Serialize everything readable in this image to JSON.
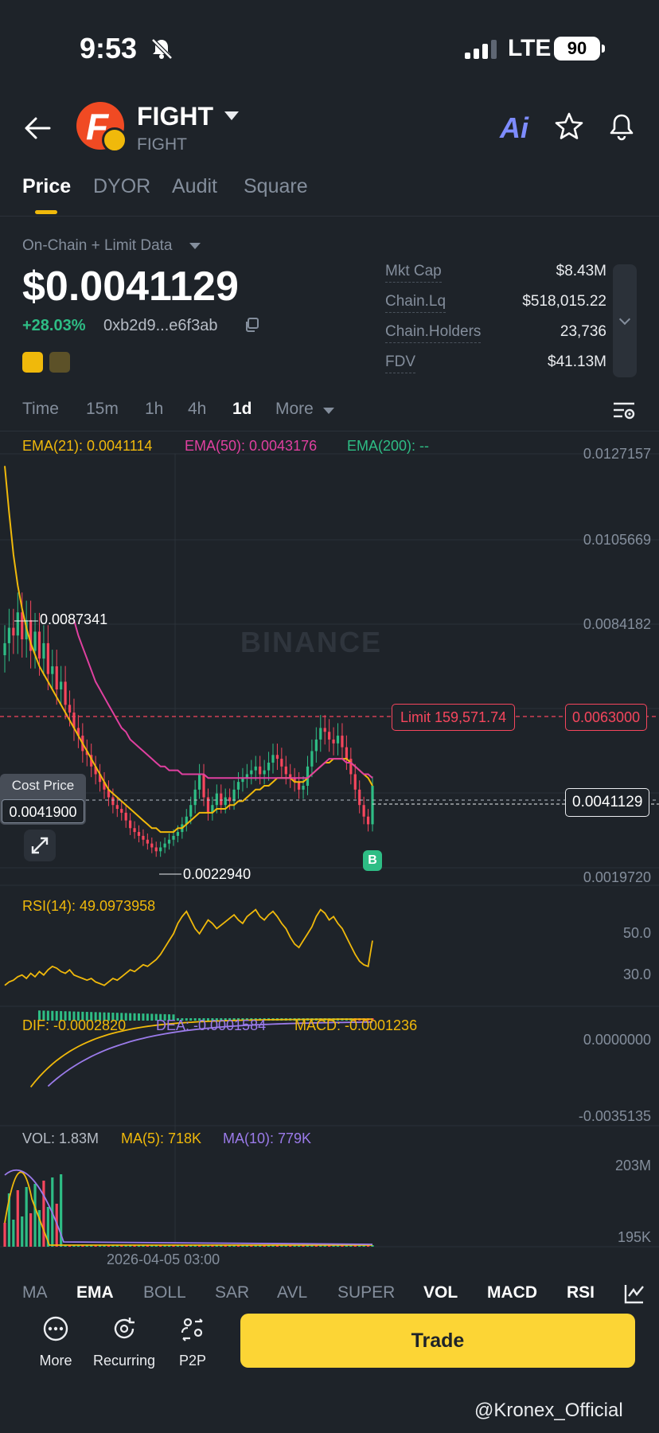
{
  "status_bar": {
    "time": "9:53",
    "network": "LTE",
    "battery": "90"
  },
  "token": {
    "name": "FIGHT",
    "subname": "FIGHT"
  },
  "header_icons": {
    "ai_label": "Ai"
  },
  "tabs": [
    "Price",
    "DYOR",
    "Audit",
    "Square"
  ],
  "data_source": "On-Chain + Limit Data",
  "price": "$0.0041129",
  "change": "+28.03%",
  "contract": "0xb2d9...e6f3ab",
  "stats": [
    {
      "label": "Mkt Cap",
      "value": "$8.43M"
    },
    {
      "label": "Chain.Lq",
      "value": "$518,015.22"
    },
    {
      "label": "Chain.Holders",
      "value": "23,736"
    },
    {
      "label": "FDV",
      "value": "$41.13M"
    }
  ],
  "timeframes": [
    "Time",
    "15m",
    "1h",
    "4h",
    "1d",
    "More"
  ],
  "active_timeframe": "1d",
  "watermark": "BINANCE",
  "overlays": {
    "limit_label": "Limit 159,571.74",
    "limit_price": "0.0063000",
    "current_price": "0.0041129",
    "cost_label": "Cost Price",
    "cost_value": "0.0041900",
    "buy_marker": "B",
    "high_label": "0.0087341",
    "low_label": "0.0022940",
    "date_label": "2026-04-05 03:00"
  },
  "indicator_tabs": [
    "MA",
    "EMA",
    "BOLL",
    "SAR",
    "AVL",
    "SUPER",
    "VOL",
    "MACD",
    "RSI"
  ],
  "bottom_nav": [
    "More",
    "Recurring",
    "P2P"
  ],
  "trade_label": "Trade",
  "footer_handle": "@Kronex_Official",
  "colors": {
    "up": "#2ebd85",
    "down": "#f6465d",
    "ema21": "#f0b90b",
    "ema50": "#e040a0",
    "ema200": "#2ebd85",
    "dea": "#9b7bea",
    "accent": "#fcd535"
  },
  "chart_data": {
    "type": "line",
    "price_panel": {
      "legend": [
        {
          "name": "EMA(21): 0.0041114",
          "color": "#f0b90b"
        },
        {
          "name": "EMA(50): 0.0043176",
          "color": "#e040a0"
        },
        {
          "name": "EMA(200): --",
          "color": "#2ebd85"
        }
      ],
      "y_ticks": [
        "0.0127157",
        "0.0105669",
        "0.0084182",
        "0.0019720"
      ],
      "ylim": [
        0.001972,
        0.0127157
      ],
      "close": [
        0.0078,
        0.0082,
        0.008,
        0.0086,
        0.0079,
        0.0084,
        0.0076,
        0.0081,
        0.0074,
        0.0078,
        0.007,
        0.0072,
        0.0066,
        0.0068,
        0.0062,
        0.006,
        0.0056,
        0.0054,
        0.005,
        0.0049,
        0.0046,
        0.0044,
        0.0042,
        0.004,
        0.0038,
        0.0036,
        0.0035,
        0.0034,
        0.0032,
        0.003,
        0.0029,
        0.0028,
        0.0027,
        0.0026,
        0.0025,
        0.0024,
        0.0025,
        0.0026,
        0.0027,
        0.0028,
        0.0029,
        0.0031,
        0.0033,
        0.0036,
        0.004,
        0.0044,
        0.0038,
        0.0034,
        0.0036,
        0.0039,
        0.0036,
        0.0038,
        0.0037,
        0.004,
        0.0042,
        0.0043,
        0.0044,
        0.0045,
        0.0046,
        0.0044,
        0.0045,
        0.0047,
        0.0049,
        0.0048,
        0.0046,
        0.0044,
        0.0043,
        0.0042,
        0.004,
        0.0041,
        0.0046,
        0.005,
        0.0053,
        0.0056,
        0.0055,
        0.0053,
        0.0052,
        0.0054,
        0.0051,
        0.0048,
        0.0044,
        0.004,
        0.0036,
        0.0033,
        0.0031,
        0.0041
      ],
      "ema21": [
        0.0124,
        0.0112,
        0.0101,
        0.0093,
        0.0087,
        0.0082,
        0.0078,
        0.0075,
        0.0072,
        0.007,
        0.0068,
        0.0066,
        0.0064,
        0.0062,
        0.006,
        0.0058,
        0.0056,
        0.0054,
        0.0052,
        0.005,
        0.0048,
        0.0046,
        0.0044,
        0.0042,
        0.004,
        0.0039,
        0.0038,
        0.0037,
        0.0036,
        0.0035,
        0.0034,
        0.0033,
        0.0032,
        0.0031,
        0.003,
        0.003,
        0.0029,
        0.0029,
        0.0029,
        0.0029,
        0.003,
        0.003,
        0.0031,
        0.0032,
        0.0033,
        0.0034,
        0.0034,
        0.0034,
        0.0034,
        0.0035,
        0.0035,
        0.0035,
        0.0036,
        0.0036,
        0.0037,
        0.0037,
        0.0038,
        0.0039,
        0.004,
        0.004,
        0.0041,
        0.0041,
        0.0042,
        0.0043,
        0.0043,
        0.0043,
        0.0043,
        0.0042,
        0.0042,
        0.0042,
        0.0043,
        0.0044,
        0.0045,
        0.0046,
        0.0047,
        0.0047,
        0.0048,
        0.0048,
        0.0048,
        0.0048,
        0.0047,
        0.0046,
        0.0045,
        0.0044,
        0.0043,
        0.0041
      ],
      "ema50": [
        null,
        null,
        null,
        null,
        null,
        null,
        null,
        null,
        null,
        null,
        null,
        null,
        null,
        null,
        null,
        null,
        0.0084,
        0.008,
        0.0077,
        0.0074,
        0.0071,
        0.0068,
        0.0066,
        0.0064,
        0.0062,
        0.006,
        0.0058,
        0.0056,
        0.0055,
        0.0053,
        0.0052,
        0.0051,
        0.005,
        0.0049,
        0.0048,
        0.0047,
        0.0046,
        0.0046,
        0.0045,
        0.0045,
        0.0045,
        0.0044,
        0.0044,
        0.0044,
        0.0044,
        0.0044,
        0.0044,
        0.0043,
        0.0043,
        0.0043,
        0.0043,
        0.0043,
        0.0043,
        0.0043,
        0.0043,
        0.0043,
        0.0043,
        0.0043,
        0.0043,
        0.0043,
        0.0043,
        0.0043,
        0.0043,
        0.0043,
        0.0043,
        0.0043,
        0.0043,
        0.0043,
        0.0043,
        0.0043,
        0.0043,
        0.0044,
        0.0045,
        0.0046,
        0.0047,
        0.0048,
        0.0048,
        0.0048,
        0.0048,
        0.0047,
        0.0047,
        0.0046,
        0.0045,
        0.0044,
        0.0044,
        0.0043
      ]
    },
    "rsi_panel": {
      "legend": "RSI(14): 49.0973958",
      "y_ticks": [
        "50.0",
        "30.0"
      ],
      "values": [
        22,
        24,
        25,
        27,
        28,
        26,
        29,
        27,
        30,
        28,
        31,
        33,
        32,
        30,
        29,
        31,
        28,
        27,
        26,
        25,
        26,
        24,
        23,
        22,
        24,
        26,
        25,
        27,
        29,
        31,
        30,
        32,
        34,
        33,
        35,
        37,
        40,
        44,
        48,
        52,
        58,
        62,
        65,
        60,
        55,
        52,
        56,
        60,
        58,
        55,
        57,
        59,
        61,
        63,
        60,
        58,
        62,
        64,
        66,
        62,
        60,
        63,
        65,
        62,
        58,
        55,
        50,
        46,
        44,
        48,
        52,
        56,
        62,
        66,
        64,
        60,
        62,
        58,
        55,
        50,
        45,
        40,
        36,
        34,
        33,
        48
      ]
    },
    "macd_panel": {
      "legend": [
        {
          "name": "DIF: -0.0002820",
          "color": "#f0b90b"
        },
        {
          "name": "DEA: -0.0001584",
          "color": "#9b7bea"
        },
        {
          "name": "MACD: -0.0001236",
          "color": "#f0b90b"
        }
      ],
      "y_ticks": [
        "0.0000000",
        "-0.0035135"
      ]
    },
    "vol_panel": {
      "legend": [
        {
          "name": "VOL: 1.83M",
          "color": "#b7bdc6"
        },
        {
          "name": "MA(5): 718K",
          "color": "#f0b90b"
        },
        {
          "name": "MA(10): 779K",
          "color": "#9b7bea"
        }
      ],
      "y_ticks": [
        "203M",
        "195K"
      ]
    }
  }
}
